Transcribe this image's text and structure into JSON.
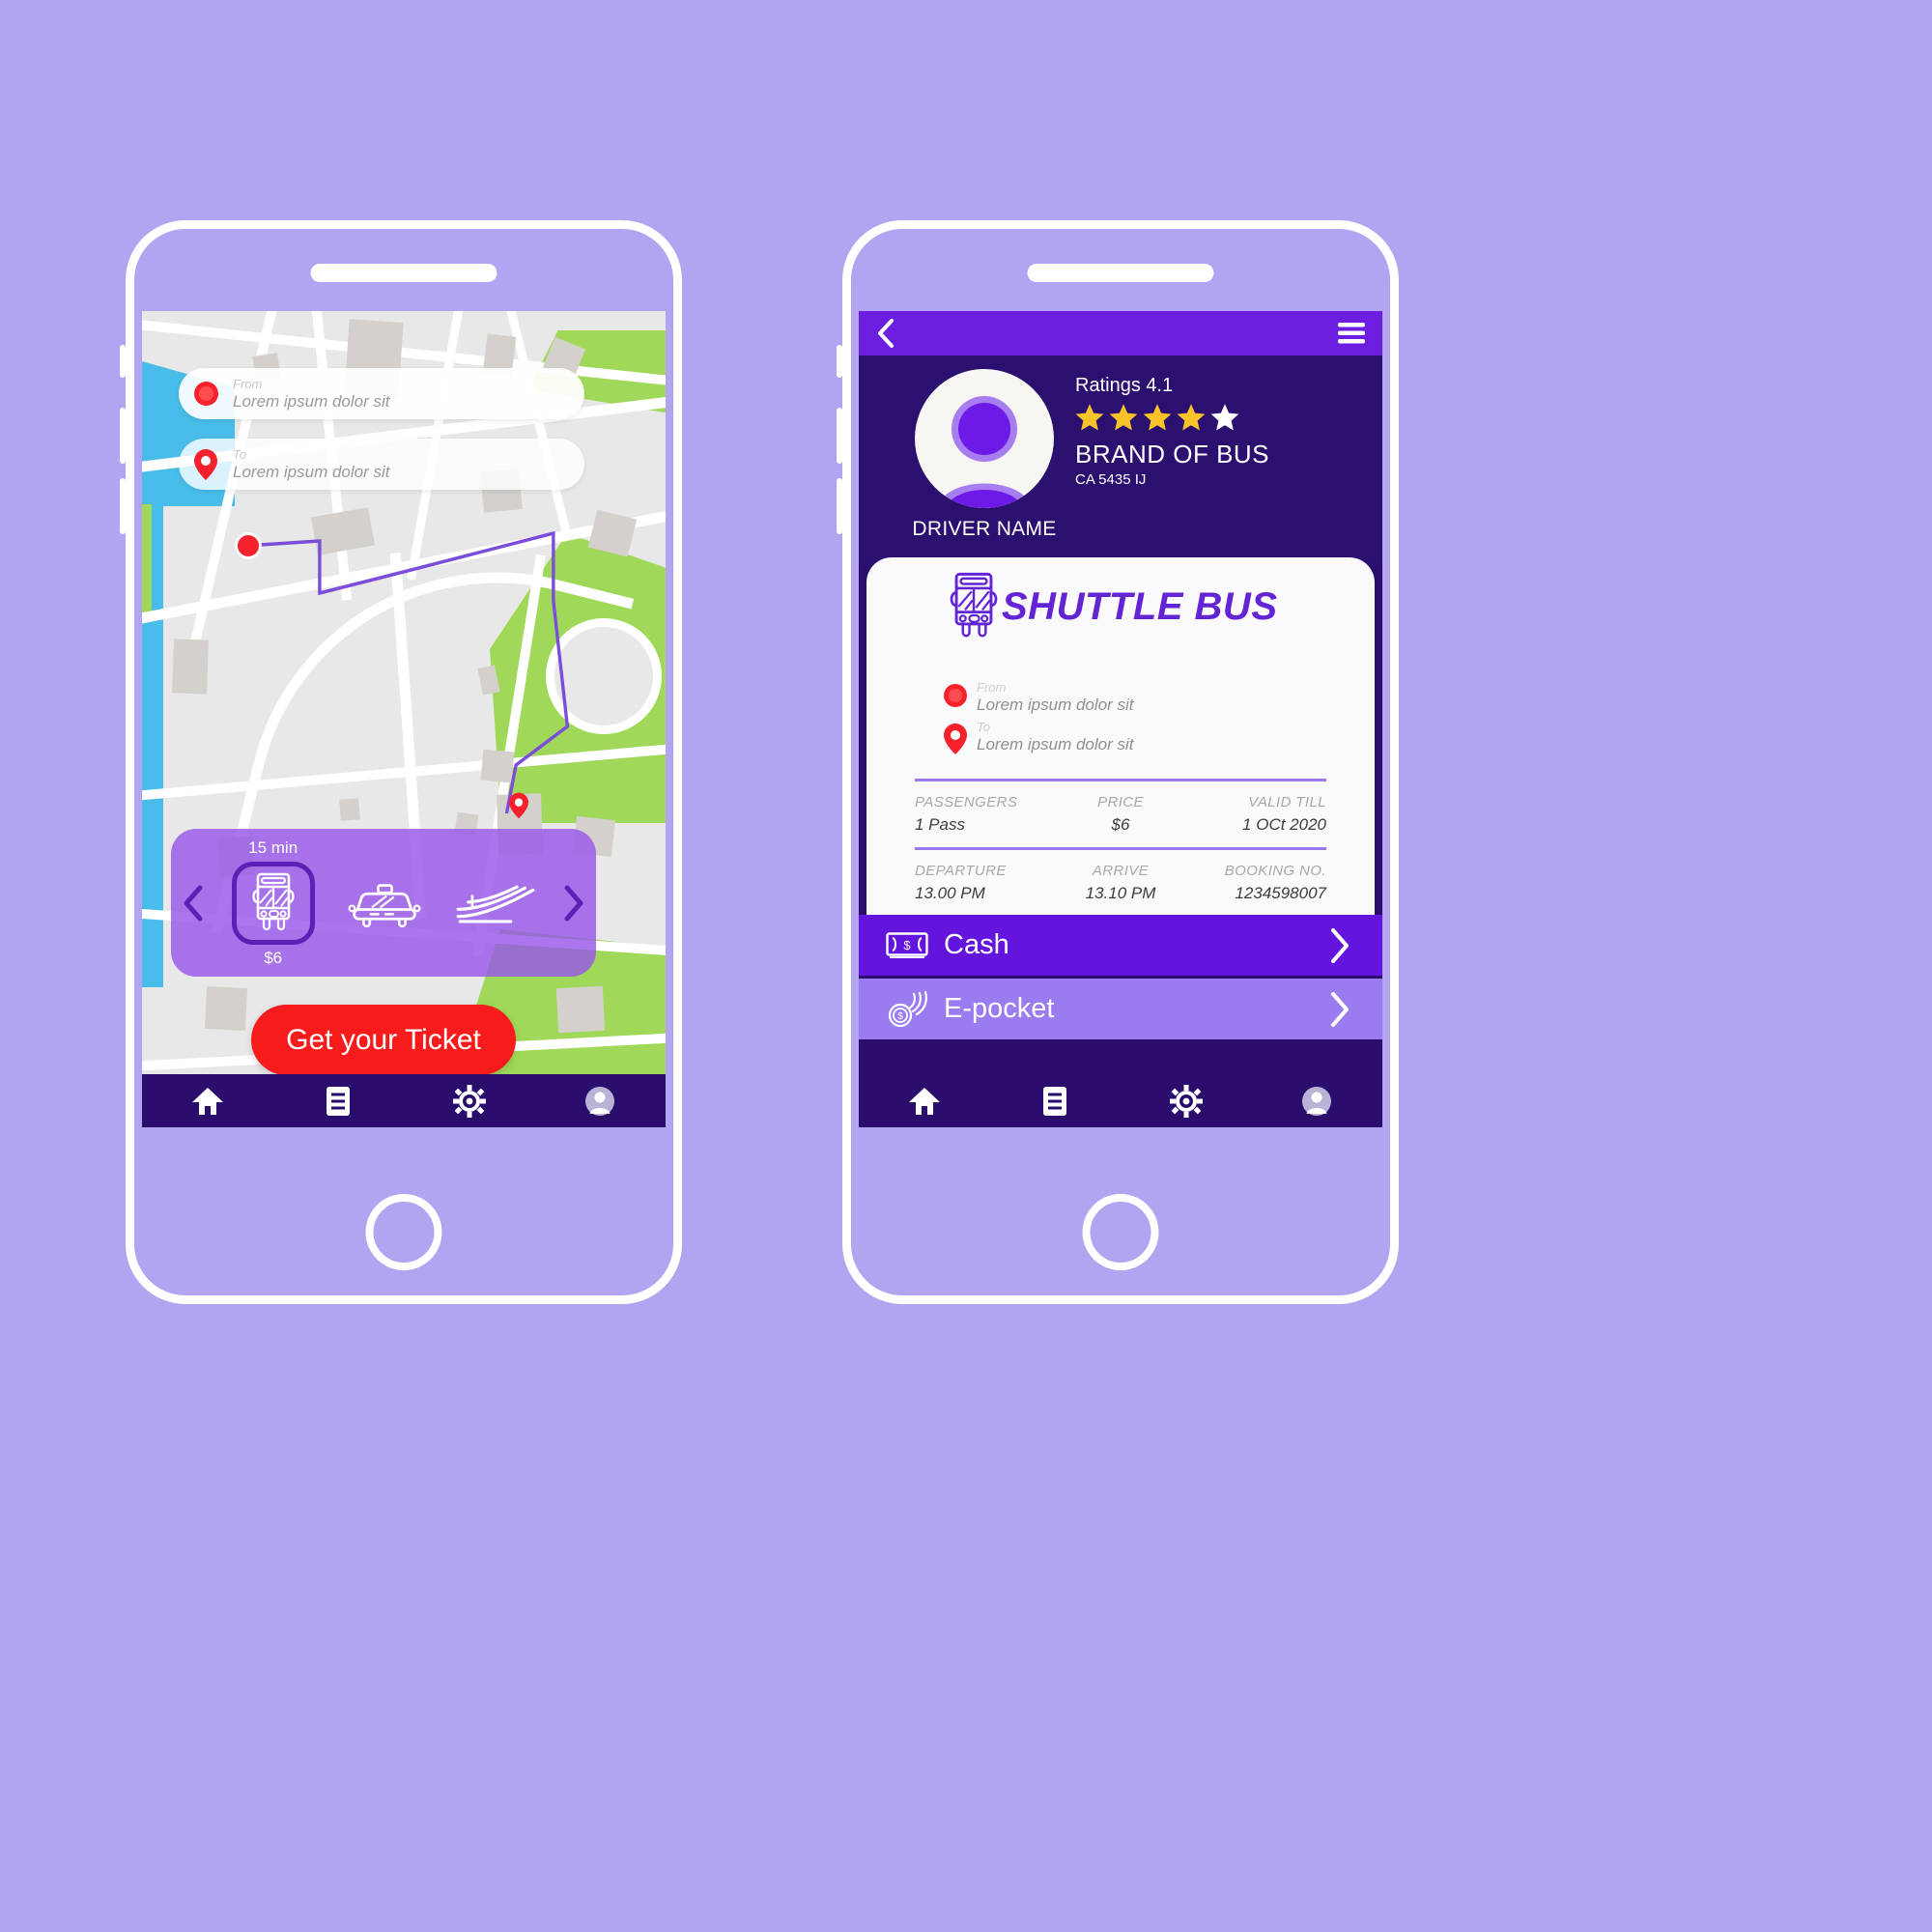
{
  "colors": {
    "page_background": "#b2a4f0",
    "brand_purple": "#6415dd",
    "deep_navy": "#2b0d6e",
    "accent_red": "#f81b1b",
    "star_gold": "#f9c32a",
    "light_purple": "#9b7bf0",
    "map_water": "#48bde9",
    "map_park": "#a0d959",
    "map_land": "#e8e8e8"
  },
  "left_phone": {
    "name": "map-booking-screen",
    "search": {
      "from": {
        "label": "From",
        "value": "Lorem ipsum dolor sit",
        "placeholder": "Lorem ipsum dolor sit",
        "icon": "circle-dot-icon"
      },
      "to": {
        "label": "To",
        "value": "Lorem ipsum dolor sit",
        "placeholder": "Lorem ipsum dolor sit",
        "icon": "map-pin-icon"
      }
    },
    "carousel": {
      "prev_label": "‹",
      "next_label": "›",
      "selected_index": 0,
      "options": [
        {
          "id": "bus",
          "icon": "bus-icon",
          "time": "15 min",
          "price": "$6",
          "selected": true
        },
        {
          "id": "taxi",
          "icon": "taxi-icon",
          "time": "",
          "price": "",
          "selected": false
        },
        {
          "id": "train",
          "icon": "train-icon",
          "time": "",
          "price": "",
          "selected": false
        }
      ]
    },
    "cta": {
      "label": "Get your Ticket"
    },
    "bottom_nav": [
      {
        "id": "home",
        "icon": "home-icon"
      },
      {
        "id": "list",
        "icon": "list-document-icon"
      },
      {
        "id": "settings",
        "icon": "gear-icon"
      },
      {
        "id": "profile",
        "icon": "user-circle-icon"
      }
    ]
  },
  "right_phone": {
    "name": "ticket-detail-screen",
    "topbar": {
      "back_icon": "chevron-left-icon",
      "menu_icon": "hamburger-menu-icon"
    },
    "driver": {
      "avatar_icon": "user-avatar-icon",
      "name": "DRIVER NAME",
      "ratings_label": "Ratings 4.1",
      "rating_value": 4.1,
      "stars_filled": 4,
      "stars_total": 5,
      "brand": "BRAND OF BUS",
      "plate": "CA 5435 IJ"
    },
    "ticket": {
      "title": "SHUTTLE BUS",
      "title_icon": "bus-icon",
      "from": {
        "label": "From",
        "value": "Lorem ipsum dolor sit",
        "icon": "circle-dot-icon"
      },
      "to": {
        "label": "To",
        "value": "Lorem ipsum dolor sit",
        "icon": "map-pin-icon"
      },
      "rows": [
        [
          {
            "header": "PASSENGERS",
            "value": "1 Pass"
          },
          {
            "header": "PRICE",
            "value": "$6"
          },
          {
            "header": "VALID TILL",
            "value": "1 OCt 2020"
          }
        ],
        [
          {
            "header": "DEPARTURE",
            "value": "13.00 PM"
          },
          {
            "header": "ARRIVE",
            "value": "13.10 PM"
          },
          {
            "header": "BOOKING NO.",
            "value": "1234598007"
          }
        ]
      ]
    },
    "payments": [
      {
        "id": "cash",
        "label": "Cash",
        "icon": "banknote-icon",
        "chevron": "chevron-right-icon"
      },
      {
        "id": "epocket",
        "label": "E-pocket",
        "icon": "contactless-coin-icon",
        "chevron": "chevron-right-icon"
      }
    ],
    "bottom_nav": [
      {
        "id": "home",
        "icon": "home-icon"
      },
      {
        "id": "list",
        "icon": "list-document-icon"
      },
      {
        "id": "settings",
        "icon": "gear-icon"
      },
      {
        "id": "profile",
        "icon": "user-circle-icon"
      }
    ]
  }
}
